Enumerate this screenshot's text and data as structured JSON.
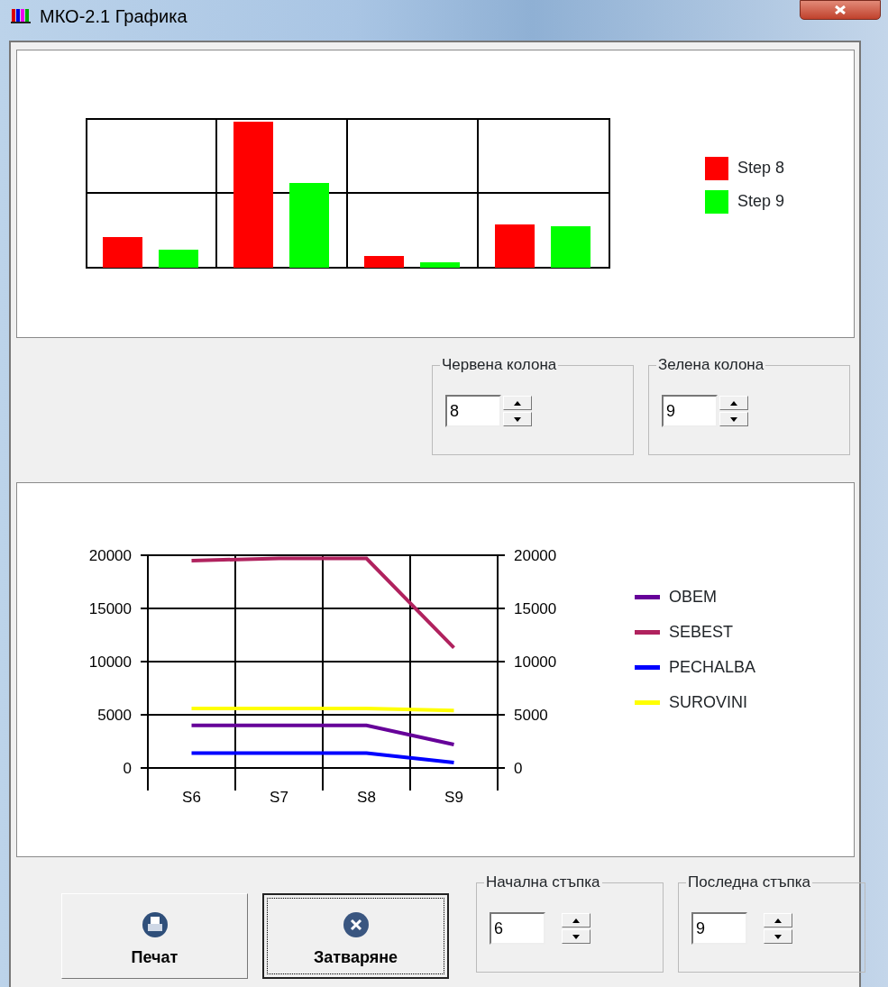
{
  "window": {
    "title": "МКО-2.1 Графика"
  },
  "bar_chart": {
    "legend": [
      {
        "label": "Step 8",
        "color": "#ff0000"
      },
      {
        "label": "Step 9",
        "color": "#00ff00"
      }
    ]
  },
  "column_pickers": [
    {
      "label": "Червена колона",
      "value": "8"
    },
    {
      "label": "Зелена колона",
      "value": "9"
    }
  ],
  "line_chart": {
    "chart_data": {
      "type": "line",
      "categories": [
        "S6",
        "S7",
        "S8",
        "S9"
      ],
      "ylim": [
        0,
        20000
      ],
      "yticks": [
        0,
        5000,
        10000,
        15000,
        20000
      ],
      "y2lim": [
        0,
        20000
      ],
      "y2ticks": [
        0,
        5000,
        10000,
        15000,
        20000
      ],
      "grid": true,
      "series": [
        {
          "name": "OBEM",
          "color": "#660099",
          "values": [
            4000,
            4000,
            4000,
            2200
          ]
        },
        {
          "name": "SEBEST",
          "color": "#b0225e",
          "values": [
            19500,
            19700,
            19700,
            11300
          ]
        },
        {
          "name": "PECHALBA",
          "color": "#0000ff",
          "values": [
            1400,
            1400,
            1400,
            500
          ]
        },
        {
          "name": "SUROVINI",
          "color": "#ffff00",
          "values": [
            5600,
            5600,
            5600,
            5400
          ]
        }
      ]
    }
  },
  "buttons": [
    {
      "label": "Печат",
      "kind": "print",
      "focused": false
    },
    {
      "label": "Затваряне",
      "kind": "close",
      "focused": true
    }
  ],
  "step_pickers": [
    {
      "label": "Начална стъпка",
      "value": "6"
    },
    {
      "label": "Последна стъпка",
      "value": "9"
    }
  ]
}
